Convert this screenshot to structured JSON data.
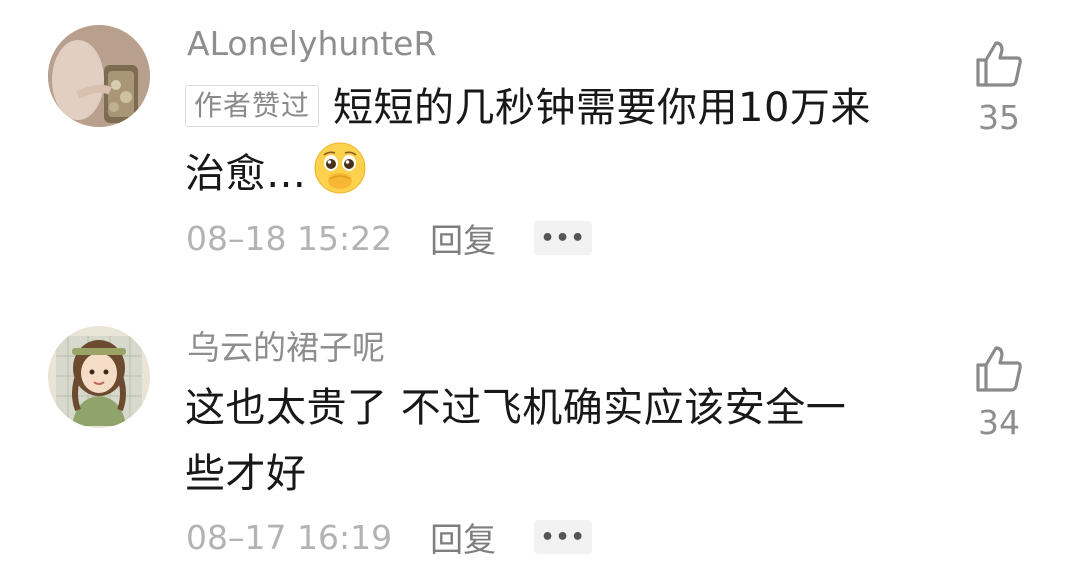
{
  "comments": [
    {
      "username": "ALonelyhunteR",
      "badge": "作者赞过",
      "text_line1": "短短的几秒钟需要你用10万来",
      "text_line2": "治愈…",
      "emoji": "pleading-face-emoji",
      "time": "08–18 15:22",
      "reply_label": "回复",
      "more_label": "•••",
      "likes": "35",
      "like_icon": "thumbs-up-icon"
    },
    {
      "username": "乌云的裙子呢",
      "text_line1": "这也太贵了 不过飞机确实应该安全一",
      "text_line2": "些才好",
      "time": "08–17 16:19",
      "reply_label": "回复",
      "more_label": "•••",
      "likes": "34",
      "like_icon": "thumbs-up-icon"
    }
  ],
  "colors": {
    "username": "#8e8e8e",
    "text": "#181818",
    "meta": "#b3b3b3",
    "more_bg": "#f2f2f2"
  }
}
